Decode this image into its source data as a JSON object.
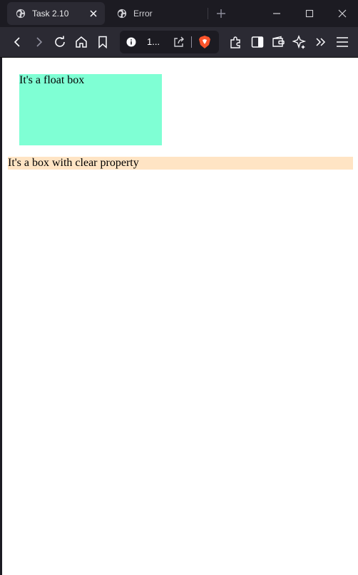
{
  "tabs": [
    {
      "title": "Task 2.10",
      "active": true
    },
    {
      "title": "Error",
      "active": false
    }
  ],
  "toolbar": {
    "url_text": "1..."
  },
  "page": {
    "float_box_text": "It's a float box",
    "clear_box_text": "It's a box with clear property"
  },
  "colors": {
    "float_box_bg": "#7fffd4",
    "clear_box_bg": "#ffe4c4",
    "chrome_dark": "#1c1b22",
    "toolbar_bg": "#2b2a33",
    "brave_orange": "#fb542b"
  },
  "icons": {
    "tab_icon": "globe-icon",
    "toolbar": [
      "back-arrow-icon",
      "forward-arrow-icon",
      "reload-icon",
      "home-icon",
      "bookmark-icon",
      "site-info-icon",
      "share-icon",
      "brave-shields-icon",
      "extensions-icon",
      "sidebar-icon",
      "wallet-icon",
      "leo-ai-icon",
      "overflow-chevrons-icon",
      "menu-icon"
    ]
  }
}
